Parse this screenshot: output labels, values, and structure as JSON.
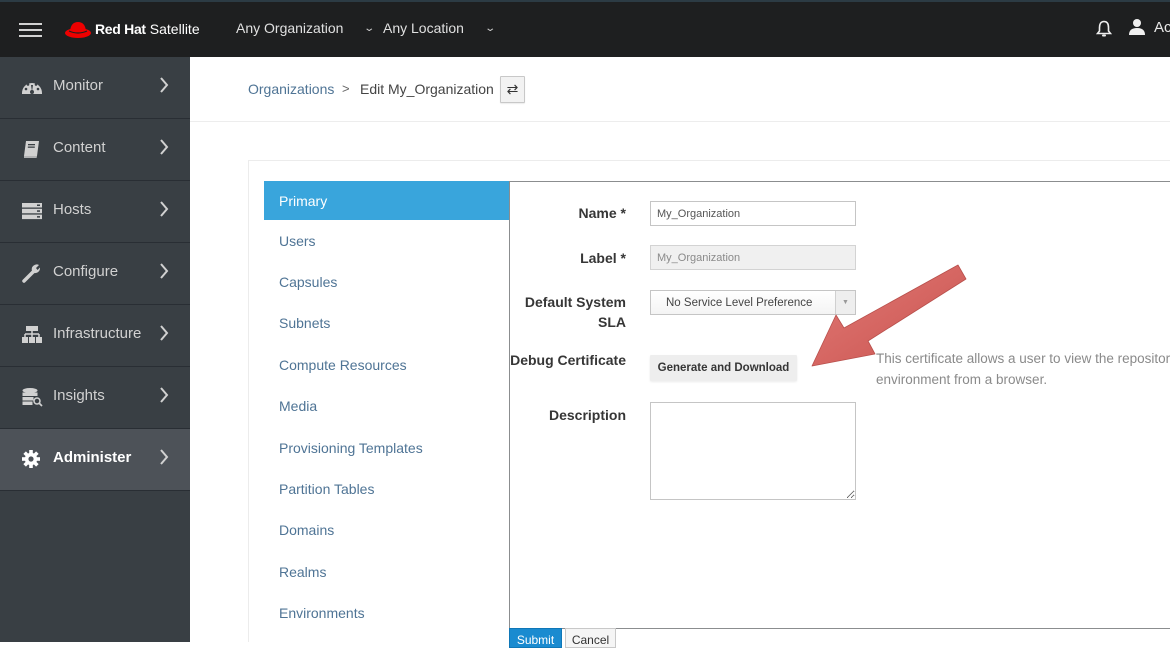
{
  "topbar": {
    "brand_bold": "Red Hat",
    "brand_light": "Satellite",
    "organization": "Any Organization",
    "location": "Any Location",
    "user_label": "Ac",
    "icons": [
      "hamburger-menu-icon",
      "redhat-logo-icon",
      "chevron-down-icon",
      "bell-icon",
      "user-icon"
    ]
  },
  "sidebar": {
    "items": [
      {
        "label": "Monitor",
        "icon": "dashboard-icon",
        "active": false
      },
      {
        "label": "Content",
        "icon": "book-icon",
        "active": false
      },
      {
        "label": "Hosts",
        "icon": "server-icon",
        "active": false
      },
      {
        "label": "Configure",
        "icon": "wrench-icon",
        "active": false
      },
      {
        "label": "Infrastructure",
        "icon": "network-icon",
        "active": false
      },
      {
        "label": "Insights",
        "icon": "database-search-icon",
        "active": false
      },
      {
        "label": "Administer",
        "icon": "gear-icon",
        "active": true
      }
    ]
  },
  "breadcrumb": {
    "parent": "Organizations",
    "separator": ">",
    "current": "Edit My_Organization",
    "switcher_icon": "⇄"
  },
  "tabs": [
    {
      "label": "Primary",
      "active": true
    },
    {
      "label": "Users"
    },
    {
      "label": "Capsules"
    },
    {
      "label": "Subnets"
    },
    {
      "label": "Compute Resources"
    },
    {
      "label": "Media"
    },
    {
      "label": "Provisioning Templates"
    },
    {
      "label": "Partition Tables"
    },
    {
      "label": "Domains"
    },
    {
      "label": "Realms"
    },
    {
      "label": "Environments"
    }
  ],
  "form": {
    "name": {
      "label": "Name *",
      "value": "My_Organization"
    },
    "label": {
      "label": "Label *",
      "value": "My_Organization",
      "disabled": true
    },
    "sla": {
      "label_line1": "Default System",
      "label_line2": "SLA",
      "selected": "No Service Level Preference",
      "caret": "▼"
    },
    "debug_cert": {
      "label": "Debug Certificate",
      "button": "Generate and Download",
      "help_line1": "This certificate allows a user to view the repositor",
      "help_line2": "environment from a browser."
    },
    "description": {
      "label": "Description",
      "value": ""
    },
    "submit": "Submit",
    "cancel": "Cancel"
  },
  "annotation": {
    "type": "arrow",
    "color": "#d9625f",
    "points_to": "Generate and Download"
  }
}
